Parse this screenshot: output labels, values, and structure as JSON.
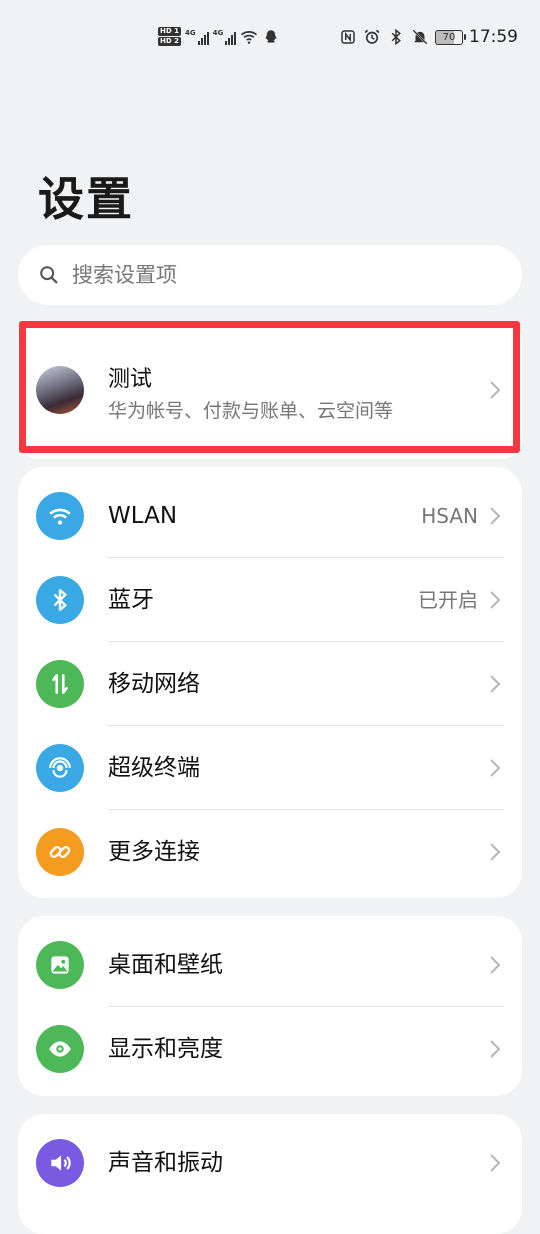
{
  "status_bar": {
    "hd1": "HD 1",
    "hd2": "HD 2",
    "net1": "4G",
    "net2": "4G",
    "battery": "70",
    "time": "17:59"
  },
  "page": {
    "title": "设置"
  },
  "search": {
    "placeholder": "搜索设置项"
  },
  "account": {
    "name": "测试",
    "subtitle": "华为帐号、付款与账单、云空间等"
  },
  "group1": [
    {
      "label": "WLAN",
      "value": "HSAN",
      "icon": "wifi-icon",
      "color": "#3ba8e6"
    },
    {
      "label": "蓝牙",
      "value": "已开启",
      "icon": "bluetooth-icon",
      "color": "#3ba8e6"
    },
    {
      "label": "移动网络",
      "value": "",
      "icon": "mobile-data-icon",
      "color": "#4cb858"
    },
    {
      "label": "超级终端",
      "value": "",
      "icon": "super-device-icon",
      "color": "#3ba8e6"
    },
    {
      "label": "更多连接",
      "value": "",
      "icon": "link-icon",
      "color": "#f39c1f"
    }
  ],
  "group2": [
    {
      "label": "桌面和壁纸",
      "value": "",
      "icon": "wallpaper-icon",
      "color": "#4cb858"
    },
    {
      "label": "显示和亮度",
      "value": "",
      "icon": "eye-icon",
      "color": "#4cb858"
    }
  ],
  "group3": [
    {
      "label": "声音和振动",
      "value": "",
      "icon": "sound-icon",
      "color": "#7a5ae0"
    }
  ],
  "colors": {
    "background": "#f1f2f4",
    "card": "#ffffff",
    "highlight": "#f43840"
  }
}
